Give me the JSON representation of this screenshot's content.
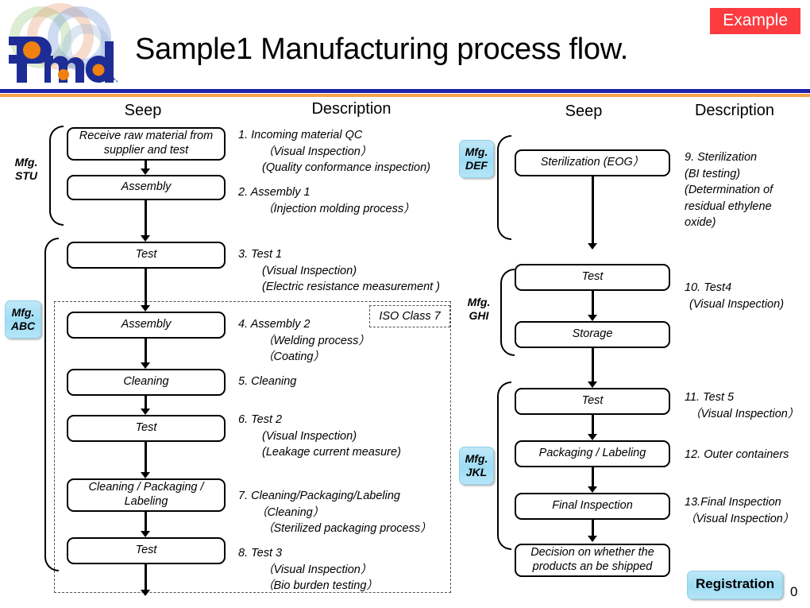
{
  "header": {
    "title": "Sample1 Manufacturing process flow.",
    "example_badge": "Example",
    "logo_text": "Pmda",
    "rule_blue": "#1C23A8",
    "rule_orange": "#F5A24B",
    "badge_color": "#FB3B40"
  },
  "columns": {
    "left_seep": "Seep",
    "left_description": "Description",
    "right_seep": "Seep",
    "right_description": "Description"
  },
  "left_flow": {
    "groups": [
      {
        "label_line1": "Mfg.",
        "label_line2": "STU",
        "badge": false
      },
      {
        "label_line1": "Mfg.",
        "label_line2": "ABC",
        "badge": true
      }
    ],
    "steps": [
      {
        "label": "Receive raw material from supplier and test"
      },
      {
        "label": "Assembly"
      },
      {
        "label": "Test"
      },
      {
        "label": "Assembly"
      },
      {
        "label": "Cleaning"
      },
      {
        "label": "Test"
      },
      {
        "label": "Cleaning / Packaging / Labeling"
      },
      {
        "label": "Test"
      }
    ],
    "clean_room_label": "ISO Class 7"
  },
  "right_flow": {
    "groups": [
      {
        "label_line1": "Mfg.",
        "label_line2": "DEF",
        "badge": true
      },
      {
        "label_line1": "Mfg.",
        "label_line2": "GHI",
        "badge": false
      },
      {
        "label_line1": "Mfg.",
        "label_line2": "JKL",
        "badge": true
      }
    ],
    "steps": [
      {
        "label": "Sterilization (EOG）"
      },
      {
        "label": "Test"
      },
      {
        "label": "Storage"
      },
      {
        "label": "Test"
      },
      {
        "label": "Packaging / Labeling"
      },
      {
        "label": "Final Inspection"
      },
      {
        "label": "Decision on whether the products an be shipped"
      }
    ]
  },
  "left_descriptions": [
    {
      "num": "1.",
      "title": "Incoming material QC",
      "subs": [
        "（Visual Inspection）",
        "(Quality conformance inspection)"
      ]
    },
    {
      "num": "2.",
      "title": "Assembly 1",
      "subs": [
        "（Injection molding process）"
      ]
    },
    {
      "num": "3.",
      "title": "Test 1",
      "subs": [
        "(Visual Inspection)",
        "(Electric resistance measurement )"
      ]
    },
    {
      "num": "4.",
      "title": "Assembly 2",
      "subs": [
        "（Welding process）",
        "（Coating）"
      ]
    },
    {
      "num": "5.",
      "title": "Cleaning",
      "subs": []
    },
    {
      "num": "6.",
      "title": "Test 2",
      "subs": [
        "(Visual Inspection)",
        "(Leakage current measure)"
      ]
    },
    {
      "num": "7.",
      "title": "Cleaning/Packaging/Labeling",
      "subs": [
        "（Cleaning）",
        "（Sterilized packaging process）"
      ]
    },
    {
      "num": "8.",
      "title": "Test 3",
      "subs": [
        "（Visual Inspection）",
        "（Bio burden testing）"
      ]
    }
  ],
  "right_descriptions": [
    {
      "num": "9.",
      "title": "Sterilization",
      "subs": [
        "(BI testing)",
        "(Determination  of",
        "residual  ethylene",
        "oxide)"
      ]
    },
    {
      "num": "10.",
      "title": "Test4",
      "subs": [
        "(Visual Inspection)"
      ]
    },
    {
      "num": "11.",
      "title": "Test 5",
      "subs": [
        "（Visual Inspection）"
      ]
    },
    {
      "num": "12.",
      "title": "Outer containers",
      "subs": []
    },
    {
      "num": "13.",
      "title": "Final  Inspection",
      "subs": [
        "（Visual Inspection）"
      ]
    }
  ],
  "footer": {
    "registration": "Registration",
    "page_number": "0"
  }
}
